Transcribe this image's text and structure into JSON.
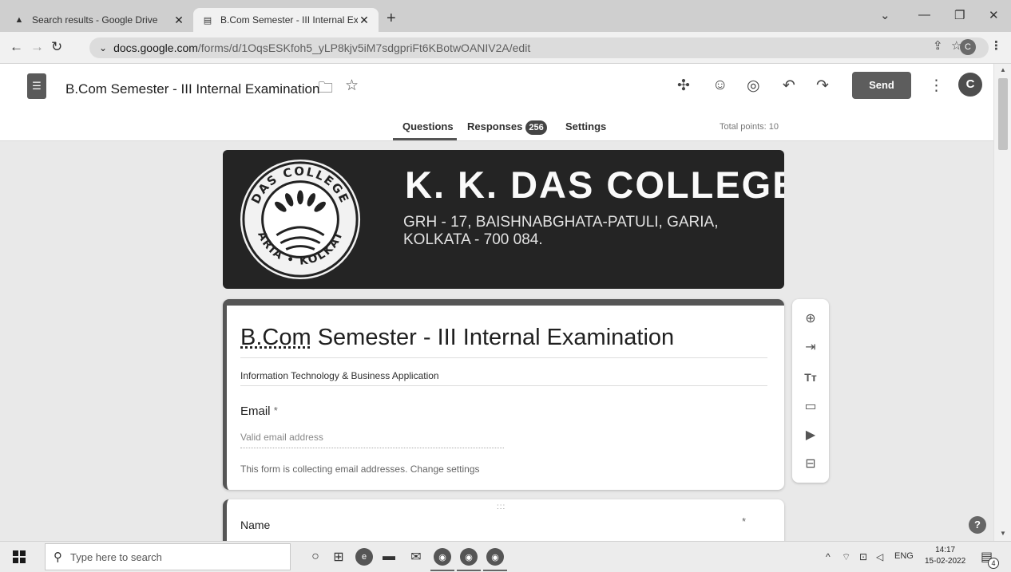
{
  "browser": {
    "tabs": [
      {
        "title": "Search results - Google Drive",
        "icon": "drive-icon"
      },
      {
        "title": "B.Com Semester - III Internal Exa",
        "icon": "forms-icon"
      }
    ],
    "url_host": "docs.google.com",
    "url_path": "/forms/d/1OqsESKfoh5_yLP8kjv5iM7sdgpriFt6KBotwOANIV2A/edit",
    "profile_initial": "C"
  },
  "forms_header": {
    "doc_title": "B.Com Semester - III Internal Examination",
    "send_label": "Send",
    "user_initial": "C",
    "tabs": {
      "questions": "Questions",
      "responses": "Responses",
      "responses_count": "256",
      "settings": "Settings"
    },
    "total_points": "Total points: 10"
  },
  "banner": {
    "college_name": "K. K. DAS COLLEGE",
    "address_line1": "GRH - 17, BAISHNABGHATA-PATULI, GARIA,",
    "address_line2": "KOLKATA - 700 084.",
    "seal_text_top": "DAS COLLEGE",
    "seal_text_left": "K. K.",
    "seal_text_bottom": "GARIA • KOLKATA"
  },
  "form": {
    "title_prefix": "B.Com",
    "title_rest": " Semester - III Internal Examination",
    "description": "Information Technology & Business Application",
    "email_label": "Email",
    "required_mark": "*",
    "email_placeholder": "Valid email address",
    "collect_note": "This form is collecting email addresses.",
    "change_settings": "Change settings",
    "question_1_label": "Name",
    "drag_handle": ":::"
  },
  "taskbar": {
    "search_placeholder": "Type here to search",
    "lang": "ENG",
    "time": "14:17",
    "date": "15-02-2022",
    "notification_count": "4"
  },
  "colors": {
    "accent": "#555555",
    "banner_bg": "#242424",
    "send_bg": "#5d5d5d"
  }
}
